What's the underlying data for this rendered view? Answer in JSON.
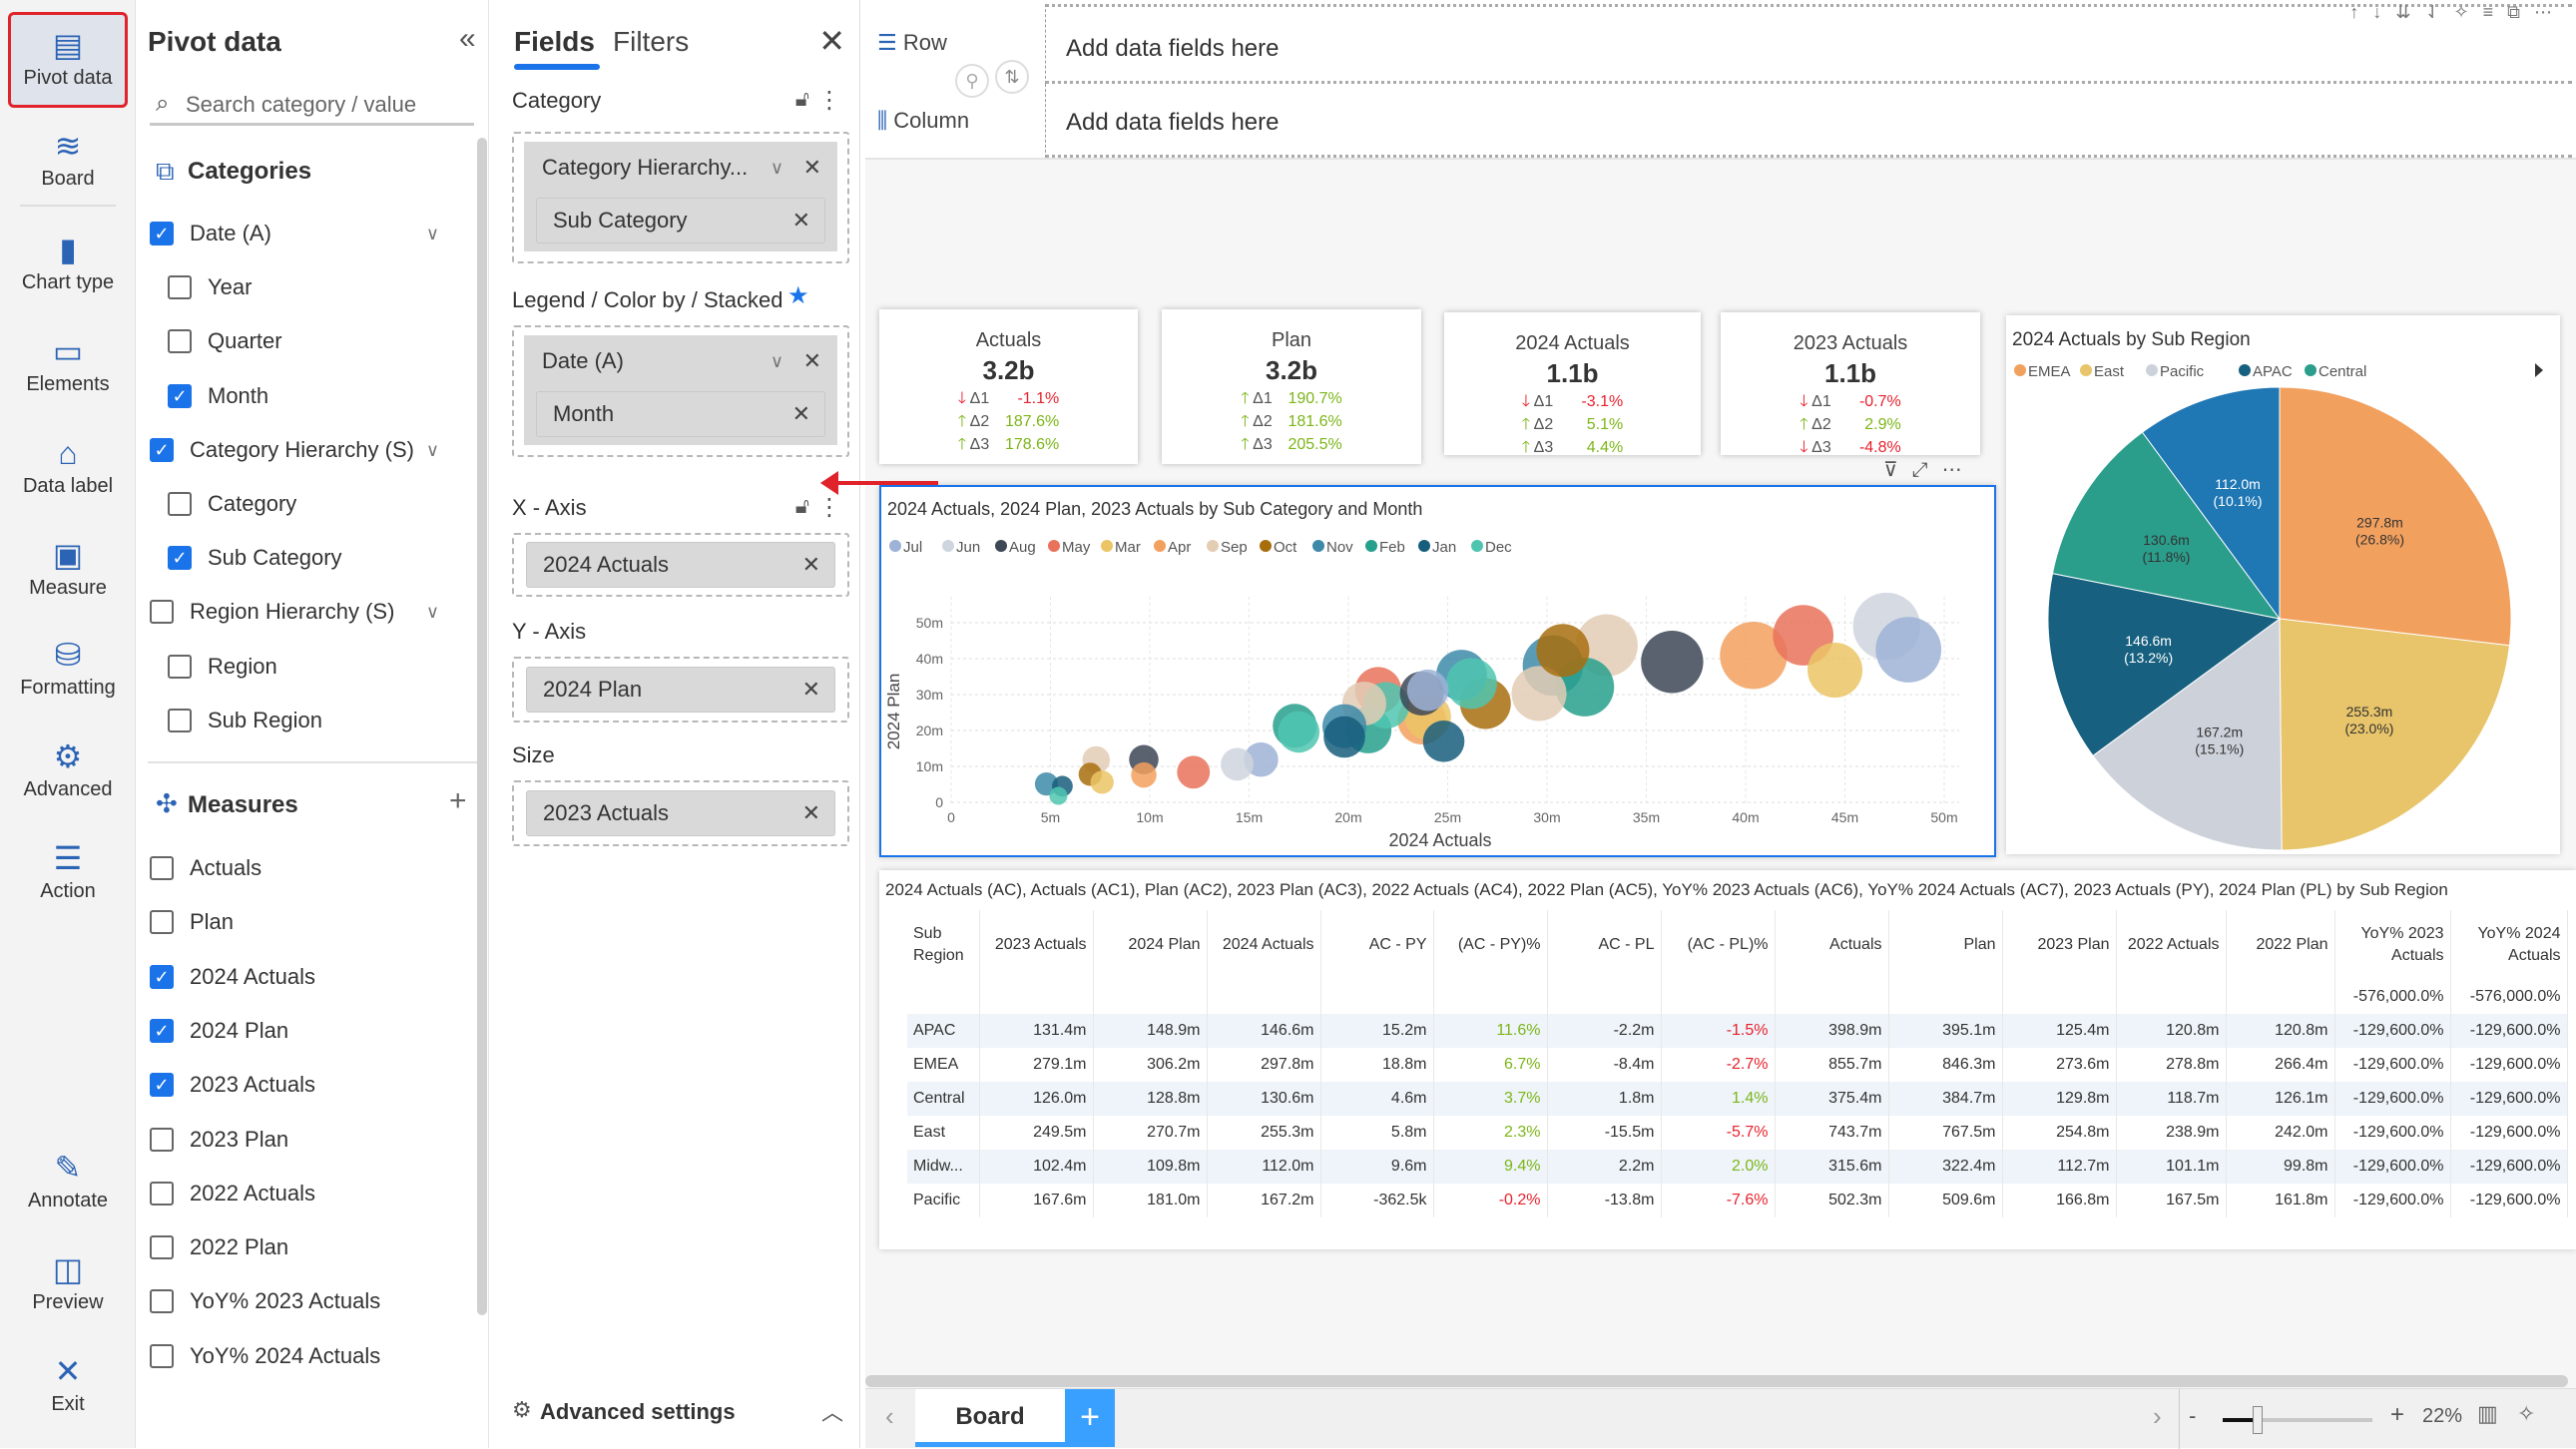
{
  "rail": {
    "items": [
      {
        "label": "Pivot data",
        "icon": "pivot-data-icon",
        "glyph": "▤",
        "active": true
      },
      {
        "label": "Board",
        "icon": "layers-icon",
        "glyph": "≋"
      },
      {
        "label": "Chart type",
        "icon": "bar-chart-icon",
        "glyph": "▮"
      },
      {
        "label": "Elements",
        "icon": "elements-icon",
        "glyph": "▭"
      },
      {
        "label": "Data label",
        "icon": "tag-icon",
        "glyph": "⌂"
      },
      {
        "label": "Measure",
        "icon": "measure-icon",
        "glyph": "▣"
      },
      {
        "label": "Formatting",
        "icon": "formatting-icon",
        "glyph": "⛁"
      },
      {
        "label": "Advanced",
        "icon": "gear-icon",
        "glyph": "⚙"
      },
      {
        "label": "Action",
        "icon": "sliders-icon",
        "glyph": "☰"
      },
      {
        "label": "Annotate",
        "icon": "annotate-icon",
        "glyph": "✎"
      },
      {
        "label": "Preview",
        "icon": "preview-icon",
        "glyph": "◫"
      },
      {
        "label": "Exit",
        "icon": "close-icon",
        "glyph": "✕"
      }
    ]
  },
  "pivot": {
    "title": "Pivot data",
    "search_placeholder": "Search category / value",
    "categories_title": "Categories",
    "categories": [
      {
        "label": "Date (A)",
        "checked": true,
        "level": 0,
        "expand": true
      },
      {
        "label": "Year",
        "checked": false,
        "level": 1
      },
      {
        "label": "Quarter",
        "checked": false,
        "level": 1
      },
      {
        "label": "Month",
        "checked": true,
        "level": 1
      },
      {
        "label": "Category Hierarchy (S)",
        "checked": true,
        "level": 0,
        "expand": true
      },
      {
        "label": "Category",
        "checked": false,
        "level": 1
      },
      {
        "label": "Sub Category",
        "checked": true,
        "level": 1
      },
      {
        "label": "Region Hierarchy (S)",
        "checked": false,
        "level": 0,
        "expand": true
      },
      {
        "label": "Region",
        "checked": false,
        "level": 1
      },
      {
        "label": "Sub Region",
        "checked": false,
        "level": 1
      }
    ],
    "measures_title": "Measures",
    "measures": [
      {
        "label": "Actuals",
        "checked": false
      },
      {
        "label": "Plan",
        "checked": false
      },
      {
        "label": "2024 Actuals",
        "checked": true
      },
      {
        "label": "2024 Plan",
        "checked": true
      },
      {
        "label": "2023 Actuals",
        "checked": true
      },
      {
        "label": "2023 Plan",
        "checked": false
      },
      {
        "label": "2022 Actuals",
        "checked": false
      },
      {
        "label": "2022 Plan",
        "checked": false
      },
      {
        "label": "YoY% 2023 Actuals",
        "checked": false
      },
      {
        "label": "YoY% 2024 Actuals",
        "checked": false
      }
    ]
  },
  "fields": {
    "tabs": [
      "Fields",
      "Filters"
    ],
    "category_label": "Category",
    "category_chips": [
      "Category Hierarchy...",
      "Sub Category"
    ],
    "legend_label": "Legend / Color by / Stacked",
    "legend_chips": [
      "Date (A)",
      "Month"
    ],
    "xaxis_label": "X - Axis",
    "xaxis_chip": "2024 Actuals",
    "yaxis_label": "Y - Axis",
    "yaxis_chip": "2024 Plan",
    "size_label": "Size",
    "size_chip": "2023 Actuals",
    "advanced": "Advanced settings"
  },
  "header": {
    "row_label": "Row",
    "column_label": "Column",
    "row_placeholder": "Add data fields here",
    "column_placeholder": "Add data fields here"
  },
  "kpis": [
    {
      "title": "Actuals",
      "value": "3.2b",
      "deltas": [
        {
          "label": "Δ1",
          "value": "-1.1%",
          "dir": "down"
        },
        {
          "label": "Δ2",
          "value": "187.6%",
          "dir": "up"
        },
        {
          "label": "Δ3",
          "value": "178.6%",
          "dir": "up"
        }
      ]
    },
    {
      "title": "Plan",
      "value": "3.2b",
      "deltas": [
        {
          "label": "Δ1",
          "value": "190.7%",
          "dir": "up"
        },
        {
          "label": "Δ2",
          "value": "181.6%",
          "dir": "up"
        },
        {
          "label": "Δ3",
          "value": "205.5%",
          "dir": "up"
        }
      ]
    },
    {
      "title": "2024 Actuals",
      "value": "1.1b",
      "deltas": [
        {
          "label": "Δ1",
          "value": "-3.1%",
          "dir": "down"
        },
        {
          "label": "Δ2",
          "value": "5.1%",
          "dir": "up"
        },
        {
          "label": "Δ3",
          "value": "4.4%",
          "dir": "up"
        }
      ]
    },
    {
      "title": "2023 Actuals",
      "value": "1.1b",
      "deltas": [
        {
          "label": "Δ1",
          "value": "-0.7%",
          "dir": "down"
        },
        {
          "label": "Δ2",
          "value": "2.9%",
          "dir": "up"
        },
        {
          "label": "Δ3",
          "value": "-4.8%",
          "dir": "down"
        }
      ]
    }
  ],
  "chart_data": [
    {
      "type": "scatter",
      "title": "2024 Actuals, 2024 Plan, 2023 Actuals by Sub Category and Month",
      "xlabel": "2024 Actuals",
      "ylabel": "2024 Plan",
      "xlim": [
        0,
        50
      ],
      "ylim": [
        0,
        50
      ],
      "xticks": [
        "0",
        "5m",
        "10m",
        "15m",
        "20m",
        "25m",
        "30m",
        "35m",
        "40m",
        "45m",
        "50m"
      ],
      "yticks": [
        "0",
        "10m",
        "20m",
        "30m",
        "40m",
        "50m"
      ],
      "grid": true,
      "legend_position": "top-left",
      "legend": [
        {
          "name": "Jul",
          "color": "#9db3d6"
        },
        {
          "name": "Jun",
          "color": "#cfd5de"
        },
        {
          "name": "Aug",
          "color": "#3d4756"
        },
        {
          "name": "May",
          "color": "#e8725a"
        },
        {
          "name": "Mar",
          "color": "#ebc465"
        },
        {
          "name": "Apr",
          "color": "#f2a05e"
        },
        {
          "name": "Sep",
          "color": "#e3cdb5"
        },
        {
          "name": "Oct",
          "color": "#a86e0e"
        },
        {
          "name": "Nov",
          "color": "#3d89a8"
        },
        {
          "name": "Feb",
          "color": "#27a08d"
        },
        {
          "name": "Jan",
          "color": "#175e7d"
        },
        {
          "name": "Dec",
          "color": "#4fc5b0"
        }
      ],
      "points": [
        {
          "month": "Nov",
          "x": 4.8,
          "y": 5.1,
          "size": 5
        },
        {
          "month": "Jan",
          "x": 5.6,
          "y": 4.5,
          "size": 4
        },
        {
          "month": "Dec",
          "x": 5.4,
          "y": 1.8,
          "size": 3
        },
        {
          "month": "Sep",
          "x": 7.3,
          "y": 11.8,
          "size": 7
        },
        {
          "month": "Oct",
          "x": 7.0,
          "y": 7.8,
          "size": 5
        },
        {
          "month": "Mar",
          "x": 7.6,
          "y": 5.6,
          "size": 5
        },
        {
          "month": "Aug",
          "x": 9.7,
          "y": 11.9,
          "size": 8
        },
        {
          "month": "Apr",
          "x": 9.7,
          "y": 7.6,
          "size": 6
        },
        {
          "month": "May",
          "x": 12.2,
          "y": 8.4,
          "size": 10
        },
        {
          "month": "Jun",
          "x": 14.4,
          "y": 10.6,
          "size": 10
        },
        {
          "month": "Jul",
          "x": 15.6,
          "y": 11.9,
          "size": 11
        },
        {
          "month": "Feb",
          "x": 17.3,
          "y": 21.3,
          "size": 18
        },
        {
          "month": "Dec",
          "x": 17.5,
          "y": 19.6,
          "size": 16
        },
        {
          "month": "Sep",
          "x": 20.8,
          "y": 27.5,
          "size": 18
        },
        {
          "month": "May",
          "x": 21.5,
          "y": 31.2,
          "size": 20
        },
        {
          "month": "Nov",
          "x": 19.8,
          "y": 21.2,
          "size": 18
        },
        {
          "month": "Jan",
          "x": 19.8,
          "y": 18.2,
          "size": 16
        },
        {
          "month": "Feb",
          "x": 21.0,
          "y": 20.1,
          "size": 20
        },
        {
          "month": "Aug",
          "x": 23.7,
          "y": 30.3,
          "size": 18
        },
        {
          "month": "Jul",
          "x": 24.0,
          "y": 31.2,
          "size": 16
        },
        {
          "month": "Apr",
          "x": 23.7,
          "y": 22.9,
          "size": 22
        },
        {
          "month": "Mar",
          "x": 24.0,
          "y": 23.8,
          "size": 20
        },
        {
          "month": "Dec",
          "x": 21.9,
          "y": 27.0,
          "size": 20
        },
        {
          "month": "Jan",
          "x": 24.8,
          "y": 17.0,
          "size": 16
        },
        {
          "month": "Oct",
          "x": 26.9,
          "y": 27.5,
          "size": 24
        },
        {
          "month": "Nov",
          "x": 25.7,
          "y": 35.4,
          "size": 24
        },
        {
          "month": "Dec",
          "x": 26.2,
          "y": 33.1,
          "size": 24
        },
        {
          "month": "Sep",
          "x": 29.6,
          "y": 30.3,
          "size": 28
        },
        {
          "month": "Oct",
          "x": 30.8,
          "y": 42.3,
          "size": 26
        },
        {
          "month": "Sep",
          "x": 33.0,
          "y": 43.7,
          "size": 36
        },
        {
          "month": "Nov",
          "x": 30.3,
          "y": 38.1,
          "size": 34
        },
        {
          "month": "Feb",
          "x": 31.9,
          "y": 32.1,
          "size": 32
        },
        {
          "month": "Aug",
          "x": 36.3,
          "y": 39.1,
          "size": 36
        },
        {
          "month": "Apr",
          "x": 40.4,
          "y": 40.9,
          "size": 42
        },
        {
          "month": "May",
          "x": 42.9,
          "y": 46.5,
          "size": 34
        },
        {
          "month": "Mar",
          "x": 44.5,
          "y": 36.8,
          "size": 28
        },
        {
          "month": "Jun",
          "x": 47.1,
          "y": 49.0,
          "size": 42
        },
        {
          "month": "Jul",
          "x": 48.2,
          "y": 42.5,
          "size": 40
        }
      ]
    },
    {
      "type": "pie",
      "title": "2024 Actuals by Sub Region",
      "legend": [
        {
          "name": "EMEA",
          "color": "#f2a05e"
        },
        {
          "name": "East",
          "color": "#e8c46a"
        },
        {
          "name": "Pacific",
          "color": "#cdd1da"
        },
        {
          "name": "APAC",
          "color": "#17607f"
        },
        {
          "name": "Central",
          "color": "#2a9d8b"
        }
      ],
      "slices": [
        {
          "name": "EMEA",
          "value": 297.8,
          "label": "297.8m",
          "pct": "(26.8%)",
          "color": "#f2a05e",
          "text": "#333"
        },
        {
          "name": "East",
          "value": 255.3,
          "label": "255.3m",
          "pct": "(23.0%)",
          "color": "#e8c46a",
          "text": "#333"
        },
        {
          "name": "Pacific",
          "value": 167.2,
          "label": "167.2m",
          "pct": "(15.1%)",
          "color": "#cdd1da",
          "text": "#333"
        },
        {
          "name": "APAC",
          "value": 146.6,
          "label": "146.6m",
          "pct": "(13.2%)",
          "color": "#17607f",
          "text": "#fff"
        },
        {
          "name": "Central",
          "value": 130.6,
          "label": "130.6m",
          "pct": "(11.8%)",
          "color": "#2a9d8b",
          "text": "#333"
        },
        {
          "value": 112.0,
          "label": "112.0m",
          "pct": "(10.1%)",
          "color": "#1f77b4",
          "text": "#fff"
        }
      ]
    },
    {
      "type": "table",
      "title": "2024 Actuals (AC), Actuals (AC1), Plan (AC2), 2023 Plan (AC3), 2022 Actuals (AC4), 2022 Plan (AC5), YoY% 2023 Actuals (AC6), YoY% 2024 Actuals (AC7), 2023 Actuals (PY), 2024 Plan (PL) by Sub Region",
      "columns": [
        "Sub Region",
        "2023 Actuals",
        "2024 Plan",
        "2024 Actuals",
        "AC - PY",
        "(AC - PY)%",
        "AC - PL",
        "(AC - PL)%",
        "Actuals",
        "Plan",
        "2023 Plan",
        "2022 Actuals",
        "2022 Plan",
        "YoY% 2023 Actuals",
        "YoY% 2024 Actuals"
      ],
      "total_row": [
        "",
        "",
        "",
        "",
        "",
        "",
        "",
        "",
        "",
        "",
        "",
        "",
        "",
        "-576,000.0%",
        "-576,000.0%"
      ],
      "rows": [
        [
          "APAC",
          "131.4m",
          "148.9m",
          "146.6m",
          "15.2m",
          "11.6%",
          "-2.2m",
          "-1.5%",
          "398.9m",
          "395.1m",
          "125.4m",
          "120.8m",
          "120.8m",
          "-129,600.0%",
          "-129,600.0%"
        ],
        [
          "EMEA",
          "279.1m",
          "306.2m",
          "297.8m",
          "18.8m",
          "6.7%",
          "-8.4m",
          "-2.7%",
          "855.7m",
          "846.3m",
          "273.6m",
          "278.8m",
          "266.4m",
          "-129,600.0%",
          "-129,600.0%"
        ],
        [
          "Central",
          "126.0m",
          "128.8m",
          "130.6m",
          "4.6m",
          "3.7%",
          "1.8m",
          "1.4%",
          "375.4m",
          "384.7m",
          "129.8m",
          "118.7m",
          "126.1m",
          "-129,600.0%",
          "-129,600.0%"
        ],
        [
          "East",
          "249.5m",
          "270.7m",
          "255.3m",
          "5.8m",
          "2.3%",
          "-15.5m",
          "-5.7%",
          "743.7m",
          "767.5m",
          "254.8m",
          "238.9m",
          "242.0m",
          "-129,600.0%",
          "-129,600.0%"
        ],
        [
          "Midw...",
          "102.4m",
          "109.8m",
          "112.0m",
          "9.6m",
          "9.4%",
          "2.2m",
          "2.0%",
          "315.6m",
          "322.4m",
          "112.7m",
          "101.1m",
          "99.8m",
          "-129,600.0%",
          "-129,600.0%"
        ],
        [
          "Pacific",
          "167.6m",
          "181.0m",
          "167.2m",
          "-362.5k",
          "-0.2%",
          "-13.8m",
          "-7.6%",
          "502.3m",
          "509.6m",
          "166.8m",
          "167.5m",
          "161.8m",
          "-129,600.0%",
          "-129,600.0%"
        ]
      ]
    }
  ],
  "footer": {
    "tab": "Board",
    "add": "+",
    "zoom": "22%",
    "zoom_minus": "-",
    "zoom_plus": "+"
  },
  "colors": {
    "accent": "#1a73e8",
    "positive": "#7cb518",
    "negative": "#e8212d",
    "active_outline": "#e0222a"
  }
}
